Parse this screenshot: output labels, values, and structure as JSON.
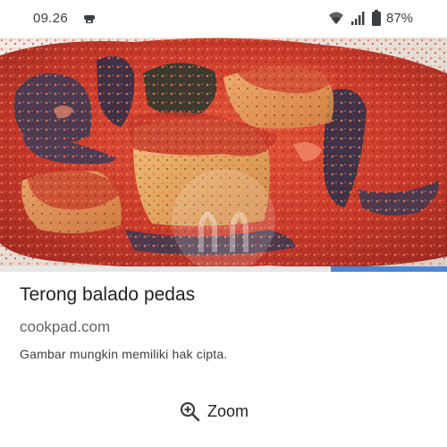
{
  "status_bar": {
    "time": "09.26",
    "battery": "87%",
    "icons": [
      "notification-icon",
      "wifi-icon",
      "signal-icon",
      "battery-icon"
    ]
  },
  "image": {
    "subject": "terong balado dish",
    "watermark_icon": "cookpad-logo-icon",
    "load_progress": 0.26
  },
  "result": {
    "title": "Terong balado pedas",
    "source": "cookpad.com",
    "notice": "Gambar mungkin memiliki hak cipta."
  },
  "actions": {
    "zoom_label": "Zoom",
    "zoom_icon": "zoom-in-icon"
  },
  "colors": {
    "progress": "#4a86d8",
    "sauce": "#c9352a"
  }
}
